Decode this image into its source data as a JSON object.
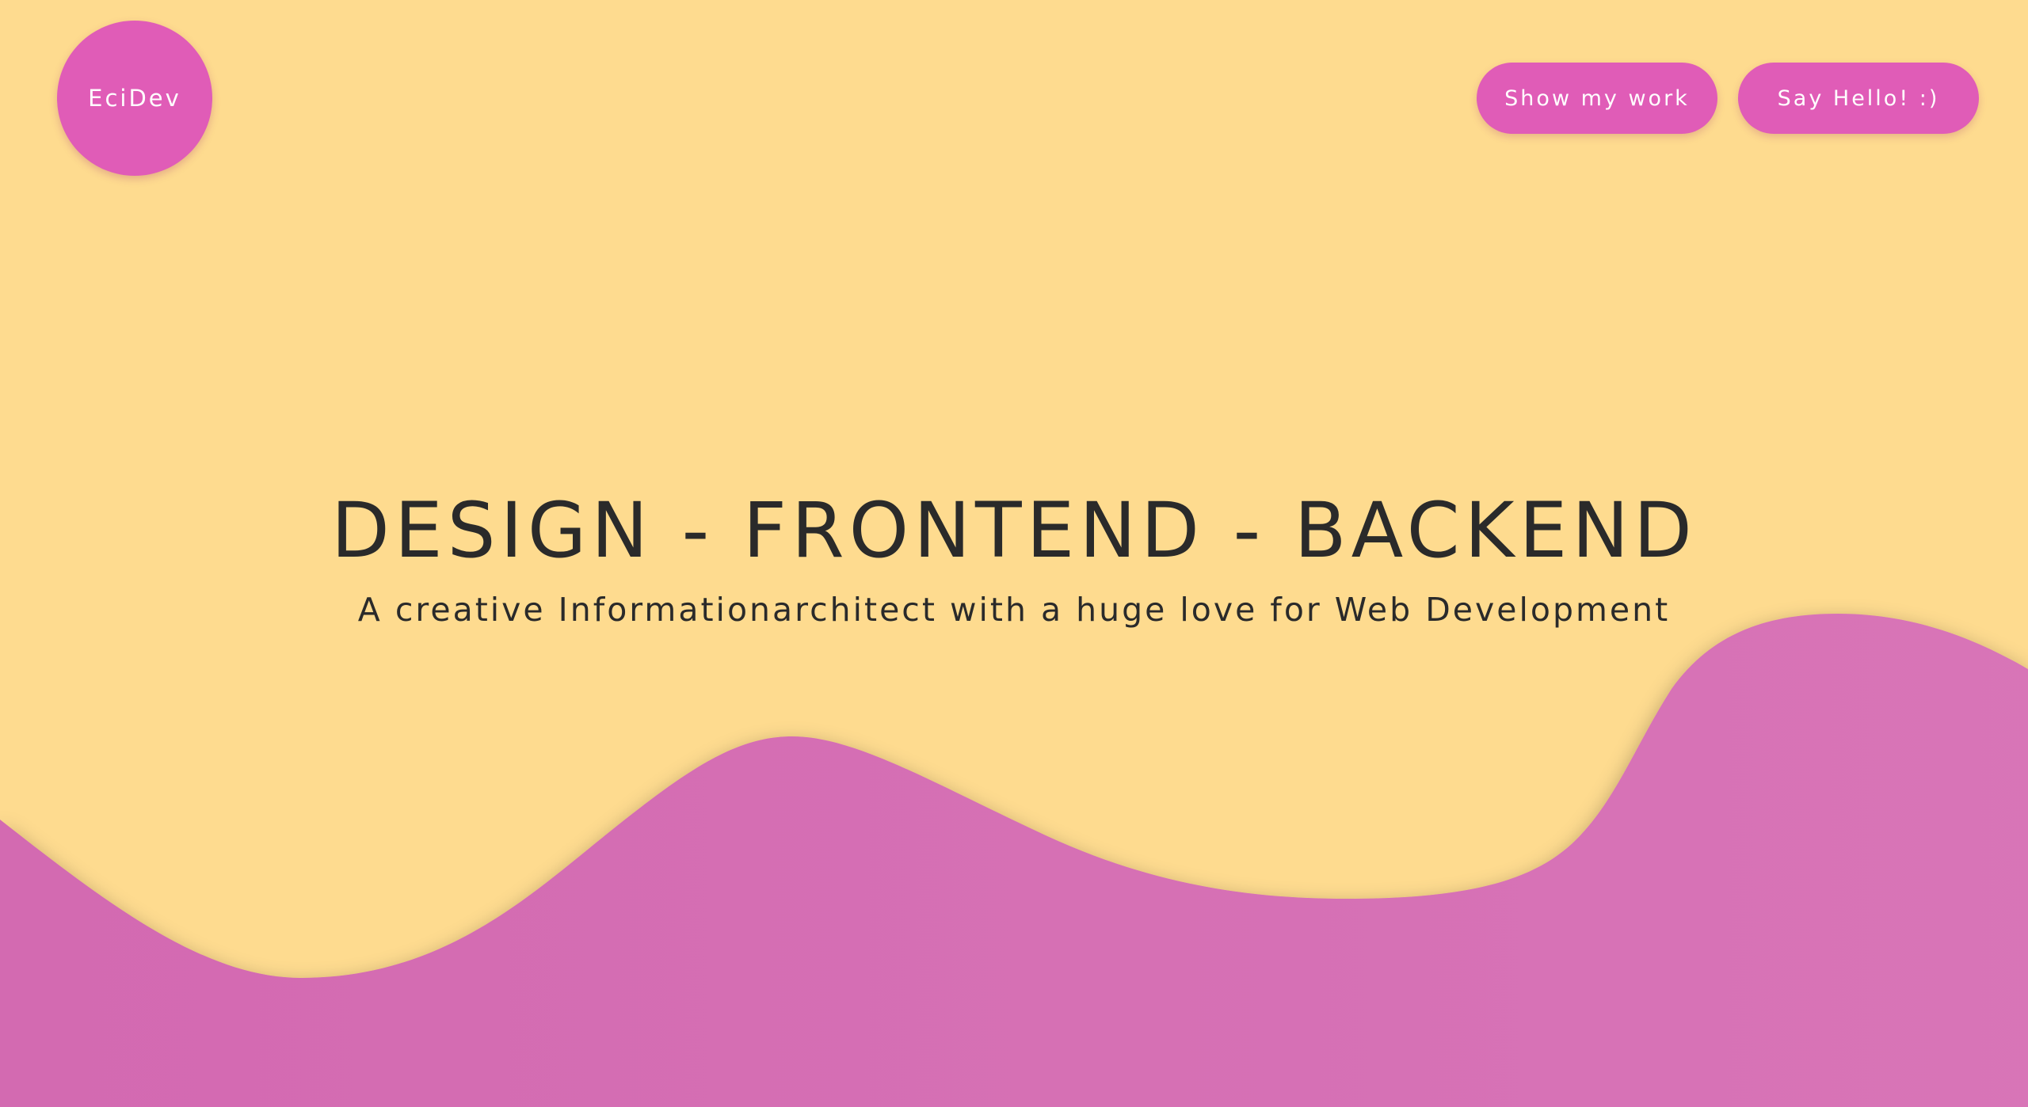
{
  "logo": {
    "label": "EciDev"
  },
  "nav": {
    "work_label": "Show my work",
    "hello_label": "Say Hello! :)"
  },
  "hero": {
    "headline": "DESIGN - FRONTEND - BACKEND",
    "tagline": "A creative Informationarchitect with a huge love for Web Development"
  },
  "colors": {
    "background": "#fedb8f",
    "accent": "#e05cb7",
    "wave": "#d56db4",
    "text": "#2a2a2a"
  }
}
